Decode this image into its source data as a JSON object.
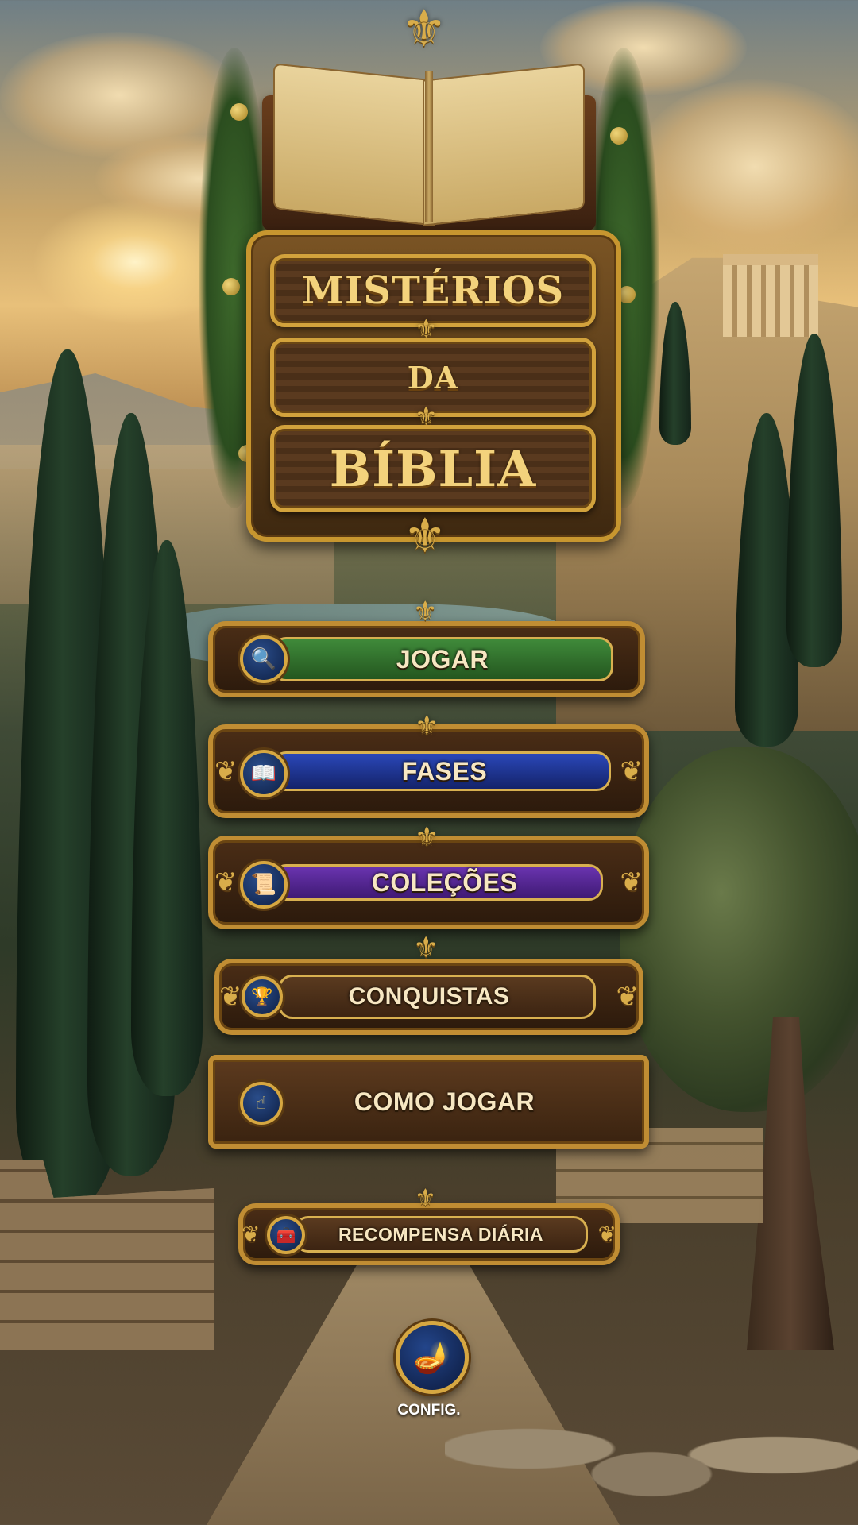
{
  "logo": {
    "line1": "MISTÉRIOS",
    "line2": "DA",
    "line3": "BÍBLIA"
  },
  "menu": {
    "play": {
      "label": "JOGAR",
      "icon": "magnifier-icon",
      "color": "#2f6b2c"
    },
    "levels": {
      "label": "FASES",
      "icon": "book-icon",
      "color": "#1b2f8a"
    },
    "collections": {
      "label": "COLEÇÕES",
      "icon": "scroll-icon",
      "color": "#5a2a8e"
    },
    "achievements": {
      "label": "CONQUISTAS",
      "icon": "trophy-icon"
    },
    "how_to_play": {
      "label": "COMO JOGAR",
      "icon": "hand-icon"
    },
    "daily_reward": {
      "label": "RECOMPENSA DIÁRIA",
      "icon": "chest-icon"
    }
  },
  "settings": {
    "label": "CONFIG.",
    "icon": "oil-lamp-icon"
  },
  "colors": {
    "gold": "#c08d33",
    "wood": "#4a2d16",
    "title_text": "#f3d27c"
  }
}
